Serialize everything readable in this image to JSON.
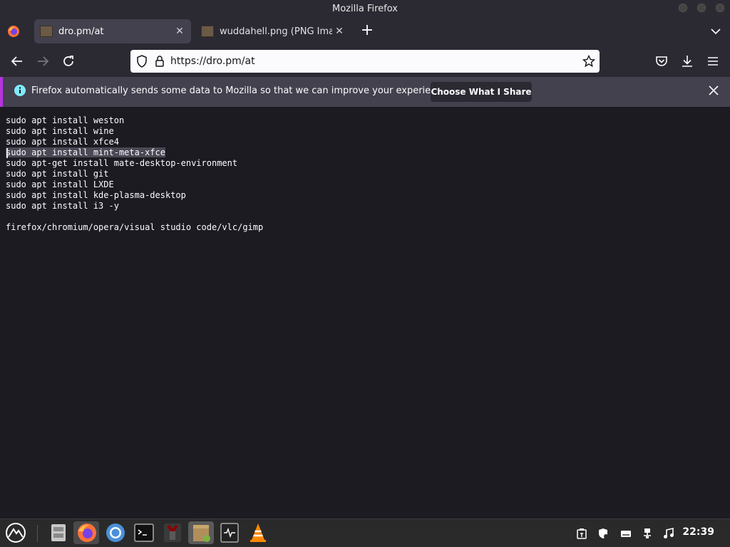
{
  "window": {
    "title": "Mozilla Firefox"
  },
  "tabs": [
    {
      "label": "dro.pm/at",
      "active": true
    },
    {
      "label": "wuddahell.png (PNG Image",
      "active": false
    }
  ],
  "navbar": {
    "url": "https://dro.pm/at"
  },
  "infobar": {
    "message": "Firefox automatically sends some data to Mozilla so that we can improve your experience.",
    "button_label": "Choose What I Share"
  },
  "page": {
    "lines": [
      "sudo apt install weston",
      "sudo apt install wine",
      "sudo apt install xfce4",
      "sudo apt install mint-meta-xfce",
      "sudo apt-get install mate-desktop-environment",
      "sudo apt install git",
      "sudo apt install LXDE",
      "sudo apt install kde-plasma-desktop",
      "sudo apt install i3 -y",
      "",
      "firefox/chromium/opera/visual studio code/vlc/gimp"
    ],
    "selected_line_index": 3
  },
  "taskbar": {
    "apps": [
      "app-menu-icon",
      "file-manager-icon",
      "firefox-icon",
      "chromium-icon",
      "terminal-icon",
      "app-icon",
      "archive-manager-icon",
      "system-monitor-icon",
      "vlc-icon"
    ],
    "tray": [
      "clipboard-icon",
      "security-icon",
      "keyboard-icon",
      "network-icon",
      "volume-icon"
    ],
    "clock": "22:39"
  },
  "colors": {
    "accent_infobar": "#b833e1",
    "chrome": "#2b2a33",
    "page_bg": "#1c1b22"
  }
}
